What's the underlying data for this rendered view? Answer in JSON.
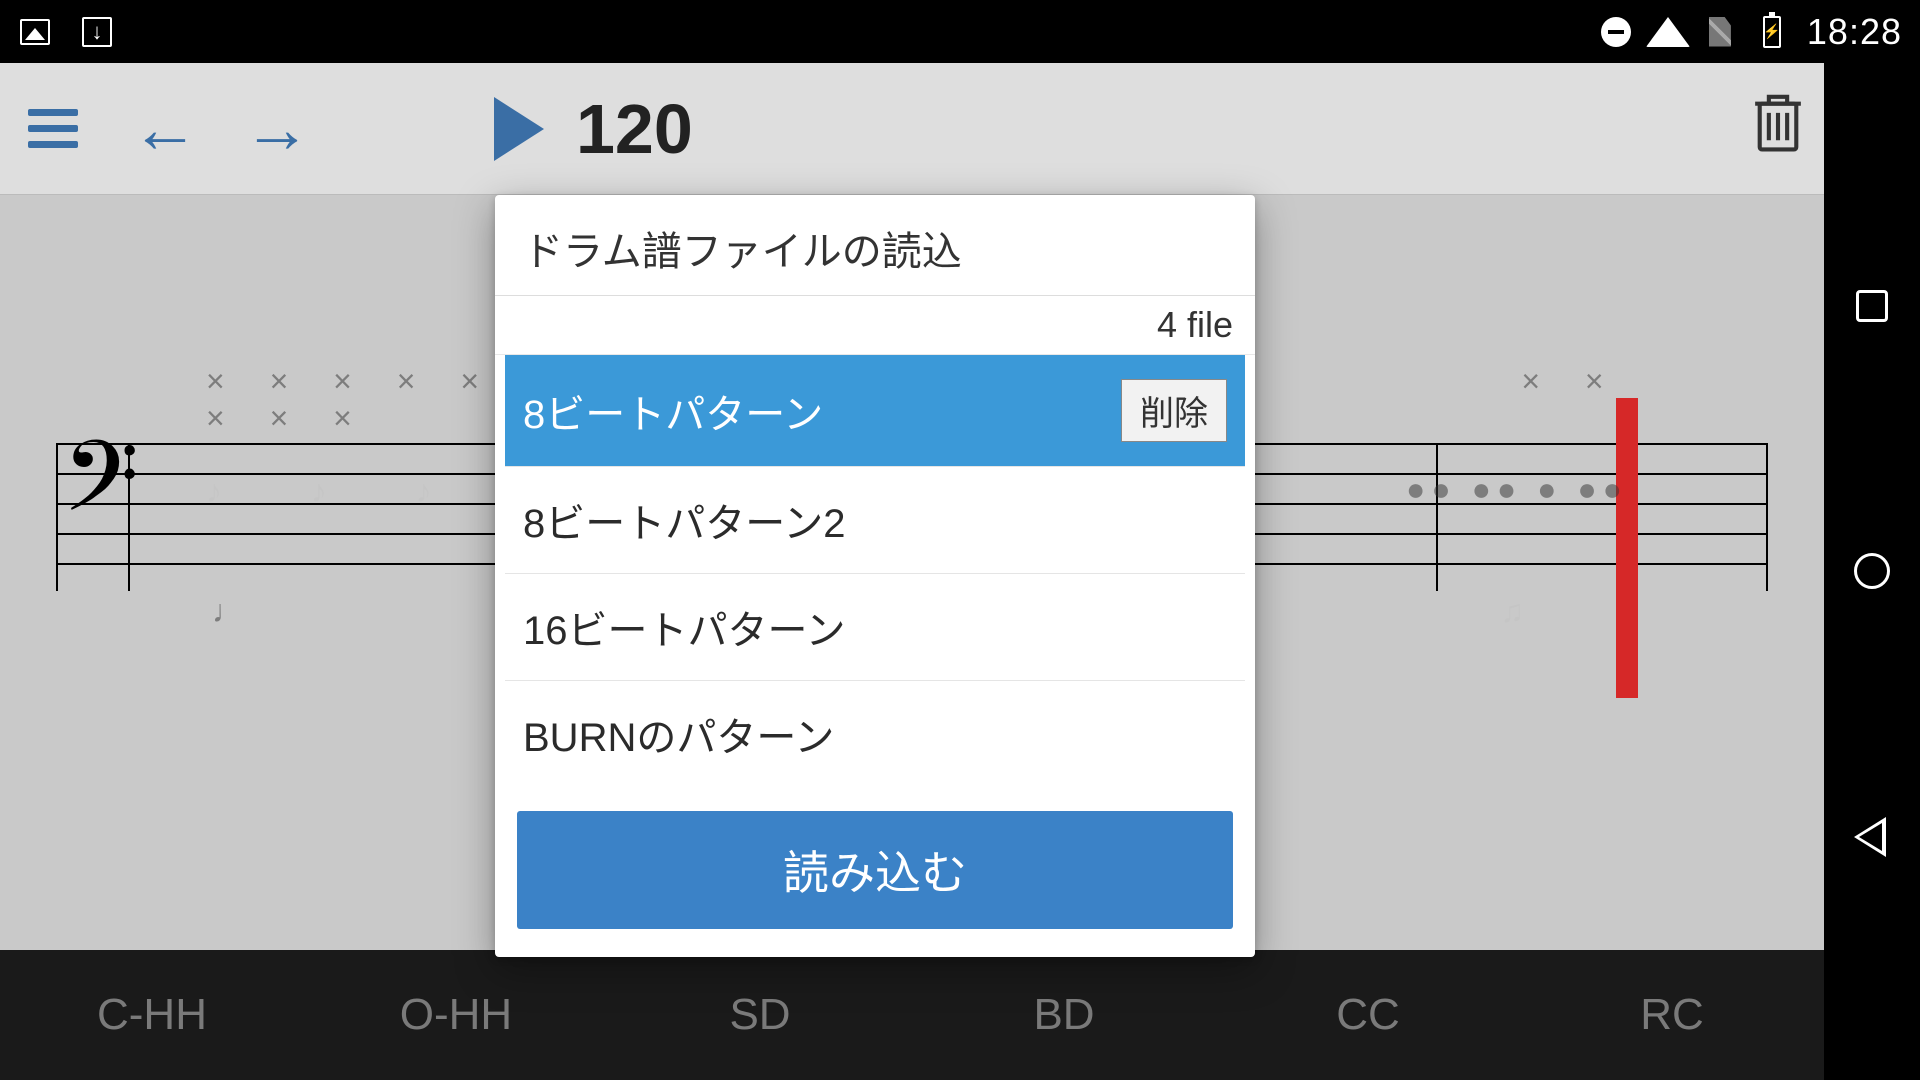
{
  "status": {
    "time": "18:28"
  },
  "toolbar": {
    "tempo": "120"
  },
  "drums": [
    "C-HH",
    "O-HH",
    "SD",
    "BD",
    "CC",
    "RC"
  ],
  "dialog": {
    "title": "ドラム譜ファイルの読込",
    "count_label": "4 file",
    "delete_label": "削除",
    "items": [
      {
        "label": "8ビートパターン",
        "selected": true
      },
      {
        "label": "8ビートパターン2",
        "selected": false
      },
      {
        "label": "16ビートパターン",
        "selected": false
      },
      {
        "label": "BURNのパターン",
        "selected": false
      }
    ],
    "load_label": "読み込む"
  }
}
